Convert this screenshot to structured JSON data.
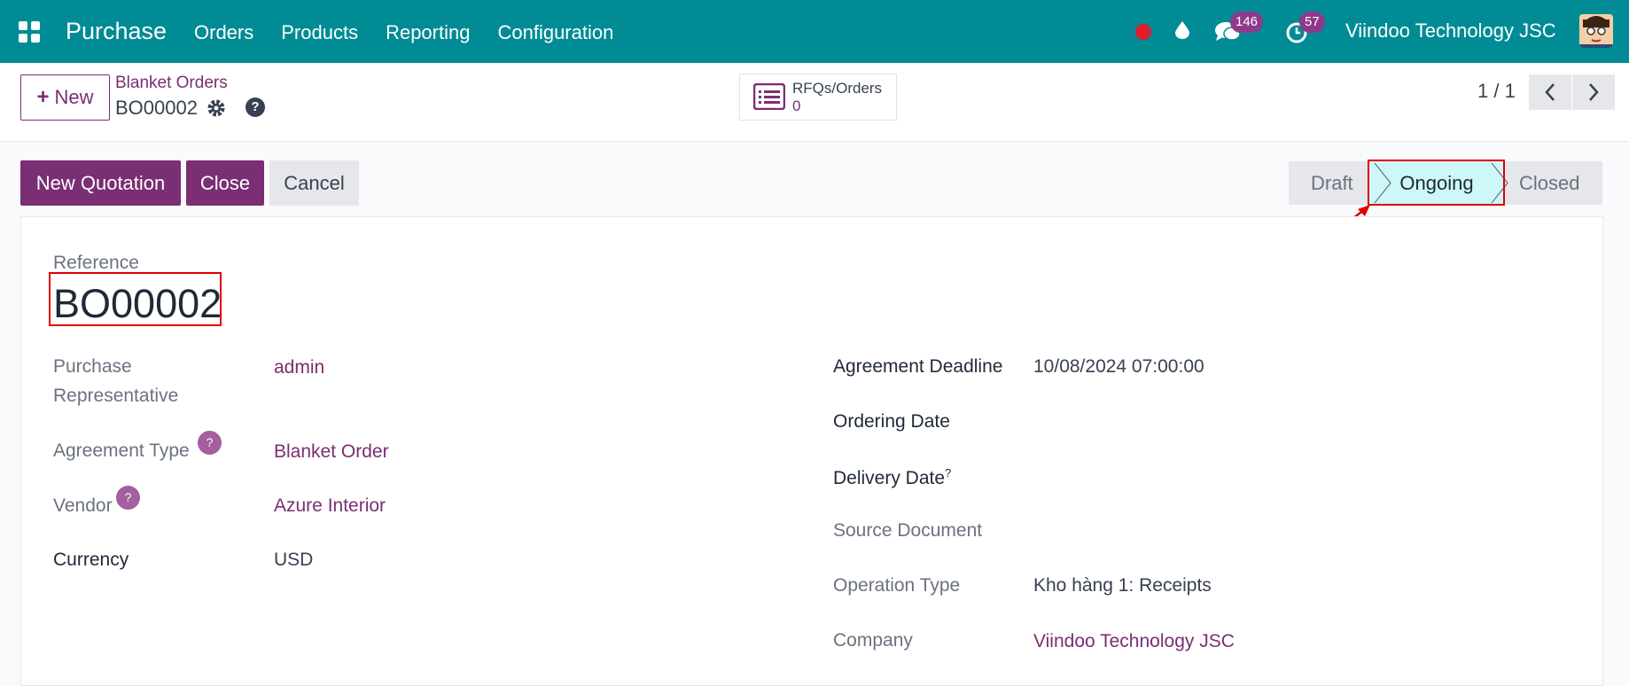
{
  "topbar": {
    "app_name": "Purchase",
    "menu": [
      "Orders",
      "Products",
      "Reporting",
      "Configuration"
    ],
    "messages_count": "146",
    "activities_count": "57",
    "company": "Viindoo Technology JSC",
    "bg_color": "#008b95"
  },
  "control_panel": {
    "new_label": "New",
    "breadcrumb_parent": "Blanket Orders",
    "breadcrumb_current": "BO00002",
    "smart_button": {
      "label": "RFQs/Orders",
      "value": "0"
    },
    "pager": "1 / 1"
  },
  "actions": {
    "new_quotation": "New Quotation",
    "close": "Close",
    "cancel": "Cancel"
  },
  "status": {
    "stages": [
      "Draft",
      "Ongoing",
      "Closed"
    ],
    "current": "Ongoing"
  },
  "form": {
    "reference_label": "Reference",
    "reference": "BO00002",
    "purchase_rep_label_1": "Purchase",
    "purchase_rep_label_2": "Representative",
    "purchase_rep": "admin",
    "agreement_type_label": "Agreement Type",
    "agreement_type": "Blanket Order",
    "vendor_label": "Vendor",
    "vendor": "Azure Interior",
    "currency_label": "Currency",
    "currency": "USD",
    "deadline_label": "Agreement Deadline",
    "deadline": "10/08/2024 07:00:00",
    "ordering_date_label": "Ordering Date",
    "delivery_date_label": "Delivery Date",
    "source_doc_label": "Source Document",
    "operation_type_label": "Operation Type",
    "operation_type": "Kho hàng 1: Receipts",
    "company_label": "Company",
    "company": "Viindoo Technology JSC"
  },
  "colors": {
    "primary": "#7a2e73",
    "active_stage": "#cdf7f8",
    "highlight": "#e00000"
  }
}
